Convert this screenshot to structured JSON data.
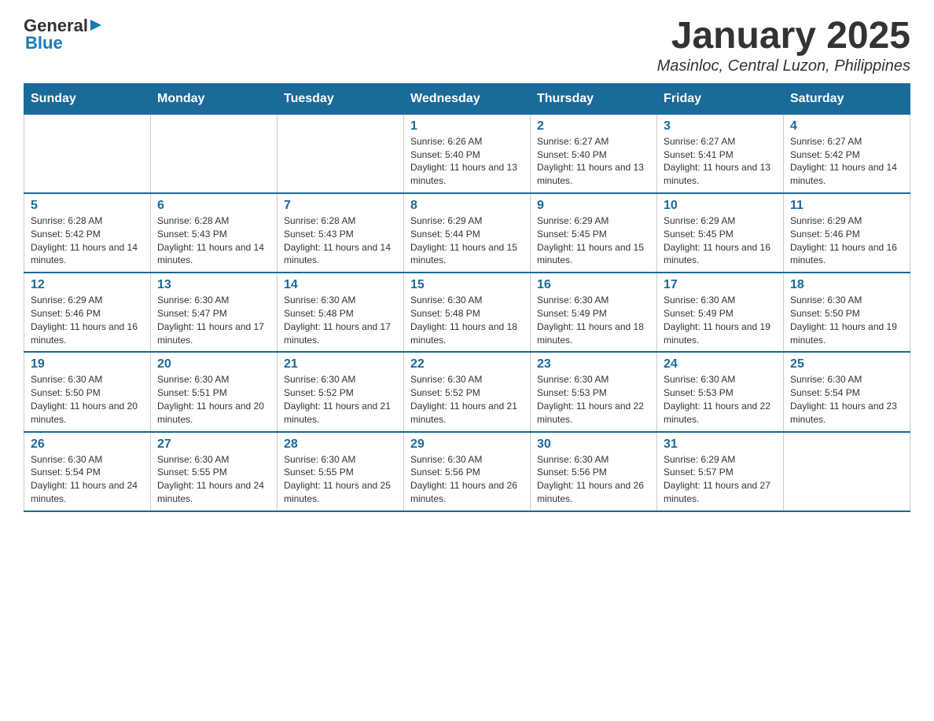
{
  "header": {
    "logo_text_black": "General",
    "logo_text_blue": "Blue",
    "month_title": "January 2025",
    "location": "Masinloc, Central Luzon, Philippines"
  },
  "days_of_week": [
    "Sunday",
    "Monday",
    "Tuesday",
    "Wednesday",
    "Thursday",
    "Friday",
    "Saturday"
  ],
  "weeks": [
    [
      {
        "day": "",
        "info": ""
      },
      {
        "day": "",
        "info": ""
      },
      {
        "day": "",
        "info": ""
      },
      {
        "day": "1",
        "info": "Sunrise: 6:26 AM\nSunset: 5:40 PM\nDaylight: 11 hours and 13 minutes."
      },
      {
        "day": "2",
        "info": "Sunrise: 6:27 AM\nSunset: 5:40 PM\nDaylight: 11 hours and 13 minutes."
      },
      {
        "day": "3",
        "info": "Sunrise: 6:27 AM\nSunset: 5:41 PM\nDaylight: 11 hours and 13 minutes."
      },
      {
        "day": "4",
        "info": "Sunrise: 6:27 AM\nSunset: 5:42 PM\nDaylight: 11 hours and 14 minutes."
      }
    ],
    [
      {
        "day": "5",
        "info": "Sunrise: 6:28 AM\nSunset: 5:42 PM\nDaylight: 11 hours and 14 minutes."
      },
      {
        "day": "6",
        "info": "Sunrise: 6:28 AM\nSunset: 5:43 PM\nDaylight: 11 hours and 14 minutes."
      },
      {
        "day": "7",
        "info": "Sunrise: 6:28 AM\nSunset: 5:43 PM\nDaylight: 11 hours and 14 minutes."
      },
      {
        "day": "8",
        "info": "Sunrise: 6:29 AM\nSunset: 5:44 PM\nDaylight: 11 hours and 15 minutes."
      },
      {
        "day": "9",
        "info": "Sunrise: 6:29 AM\nSunset: 5:45 PM\nDaylight: 11 hours and 15 minutes."
      },
      {
        "day": "10",
        "info": "Sunrise: 6:29 AM\nSunset: 5:45 PM\nDaylight: 11 hours and 16 minutes."
      },
      {
        "day": "11",
        "info": "Sunrise: 6:29 AM\nSunset: 5:46 PM\nDaylight: 11 hours and 16 minutes."
      }
    ],
    [
      {
        "day": "12",
        "info": "Sunrise: 6:29 AM\nSunset: 5:46 PM\nDaylight: 11 hours and 16 minutes."
      },
      {
        "day": "13",
        "info": "Sunrise: 6:30 AM\nSunset: 5:47 PM\nDaylight: 11 hours and 17 minutes."
      },
      {
        "day": "14",
        "info": "Sunrise: 6:30 AM\nSunset: 5:48 PM\nDaylight: 11 hours and 17 minutes."
      },
      {
        "day": "15",
        "info": "Sunrise: 6:30 AM\nSunset: 5:48 PM\nDaylight: 11 hours and 18 minutes."
      },
      {
        "day": "16",
        "info": "Sunrise: 6:30 AM\nSunset: 5:49 PM\nDaylight: 11 hours and 18 minutes."
      },
      {
        "day": "17",
        "info": "Sunrise: 6:30 AM\nSunset: 5:49 PM\nDaylight: 11 hours and 19 minutes."
      },
      {
        "day": "18",
        "info": "Sunrise: 6:30 AM\nSunset: 5:50 PM\nDaylight: 11 hours and 19 minutes."
      }
    ],
    [
      {
        "day": "19",
        "info": "Sunrise: 6:30 AM\nSunset: 5:50 PM\nDaylight: 11 hours and 20 minutes."
      },
      {
        "day": "20",
        "info": "Sunrise: 6:30 AM\nSunset: 5:51 PM\nDaylight: 11 hours and 20 minutes."
      },
      {
        "day": "21",
        "info": "Sunrise: 6:30 AM\nSunset: 5:52 PM\nDaylight: 11 hours and 21 minutes."
      },
      {
        "day": "22",
        "info": "Sunrise: 6:30 AM\nSunset: 5:52 PM\nDaylight: 11 hours and 21 minutes."
      },
      {
        "day": "23",
        "info": "Sunrise: 6:30 AM\nSunset: 5:53 PM\nDaylight: 11 hours and 22 minutes."
      },
      {
        "day": "24",
        "info": "Sunrise: 6:30 AM\nSunset: 5:53 PM\nDaylight: 11 hours and 22 minutes."
      },
      {
        "day": "25",
        "info": "Sunrise: 6:30 AM\nSunset: 5:54 PM\nDaylight: 11 hours and 23 minutes."
      }
    ],
    [
      {
        "day": "26",
        "info": "Sunrise: 6:30 AM\nSunset: 5:54 PM\nDaylight: 11 hours and 24 minutes."
      },
      {
        "day": "27",
        "info": "Sunrise: 6:30 AM\nSunset: 5:55 PM\nDaylight: 11 hours and 24 minutes."
      },
      {
        "day": "28",
        "info": "Sunrise: 6:30 AM\nSunset: 5:55 PM\nDaylight: 11 hours and 25 minutes."
      },
      {
        "day": "29",
        "info": "Sunrise: 6:30 AM\nSunset: 5:56 PM\nDaylight: 11 hours and 26 minutes."
      },
      {
        "day": "30",
        "info": "Sunrise: 6:30 AM\nSunset: 5:56 PM\nDaylight: 11 hours and 26 minutes."
      },
      {
        "day": "31",
        "info": "Sunrise: 6:29 AM\nSunset: 5:57 PM\nDaylight: 11 hours and 27 minutes."
      },
      {
        "day": "",
        "info": ""
      }
    ]
  ]
}
